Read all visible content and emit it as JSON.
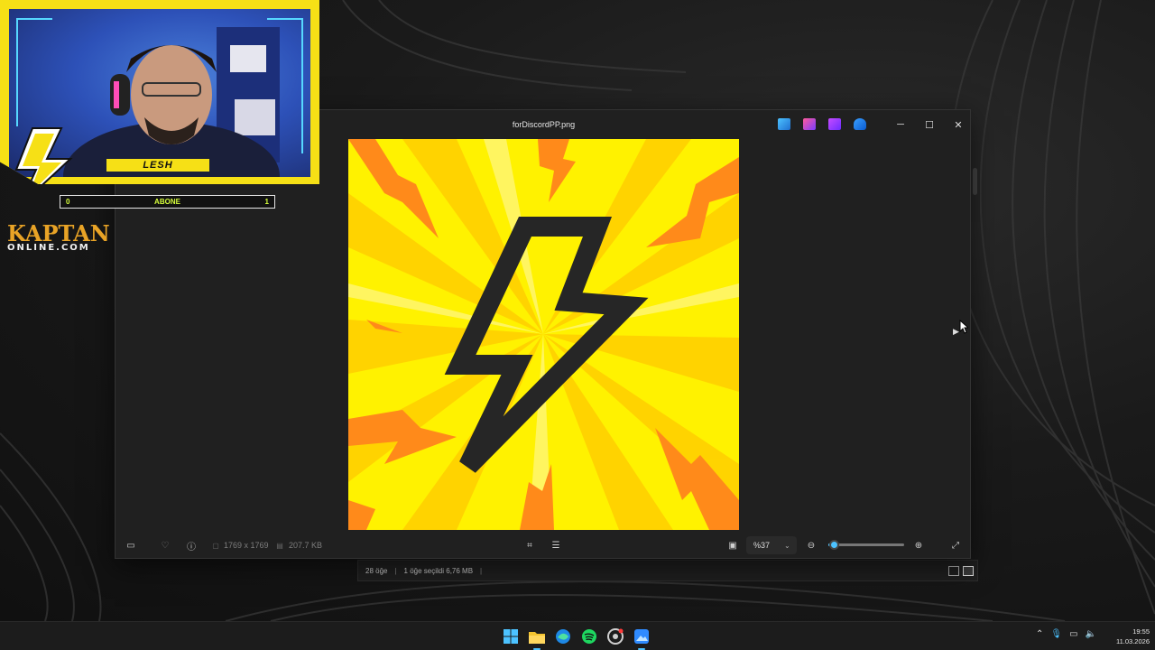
{
  "viewer": {
    "title": "forDiscordPP.png",
    "dimensions": "1769 x 1769",
    "file_size": "207.7 KB",
    "zoom_label": "%37",
    "zoom_level": 0.07,
    "icons": [
      "filmstrip-icon",
      "favorite-icon",
      "info-icon",
      "image-size-icon",
      "file-size-icon",
      "visual-search-icon",
      "text-scan-icon",
      "fit-window-icon",
      "zoom-out-icon",
      "zoom-in-icon",
      "fullscreen-icon"
    ]
  },
  "explorer": {
    "item_count": "28 öğe",
    "selection": "1 öğe seçildi  6,76 MB"
  },
  "overlay": {
    "streamer_name": "LESH",
    "sub_min": "0",
    "sub_label": "ABONE",
    "sub_max": "1",
    "brand_top": "KAPTAN",
    "brand_bottom": "ONLINE.COM"
  },
  "taskbar": {
    "apps": [
      "start-icon",
      "file-explorer-icon",
      "edge-icon",
      "spotify-icon",
      "chrome-icon",
      "photos-icon"
    ],
    "time": "19:55",
    "date": "11.03.2026"
  },
  "colors": {
    "accent": "#4cc2ff",
    "overlay_yellow": "#f6e016",
    "brand_orange": "#e8a326"
  }
}
